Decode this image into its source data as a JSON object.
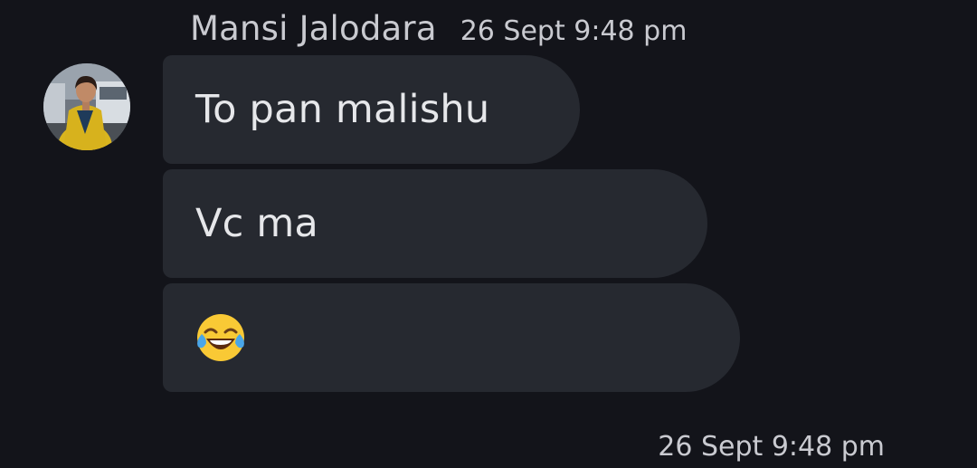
{
  "message_group": {
    "sender_name": "Mansi Jalodara",
    "timestamp": "26 Sept 9:48 pm",
    "avatar_icon": "user-avatar-photo",
    "messages": [
      {
        "text": "To pan malishu"
      },
      {
        "text": "Vc ma"
      },
      {
        "text": "😂",
        "emoji_icon": "face-with-tears-of-joy-icon"
      }
    ]
  },
  "footer": {
    "timestamp": "26 Sept 9:48 pm"
  },
  "colors": {
    "background": "#13141a",
    "bubble": "#262930",
    "text": "#e6e7ea",
    "meta_text": "#c9cad0"
  }
}
